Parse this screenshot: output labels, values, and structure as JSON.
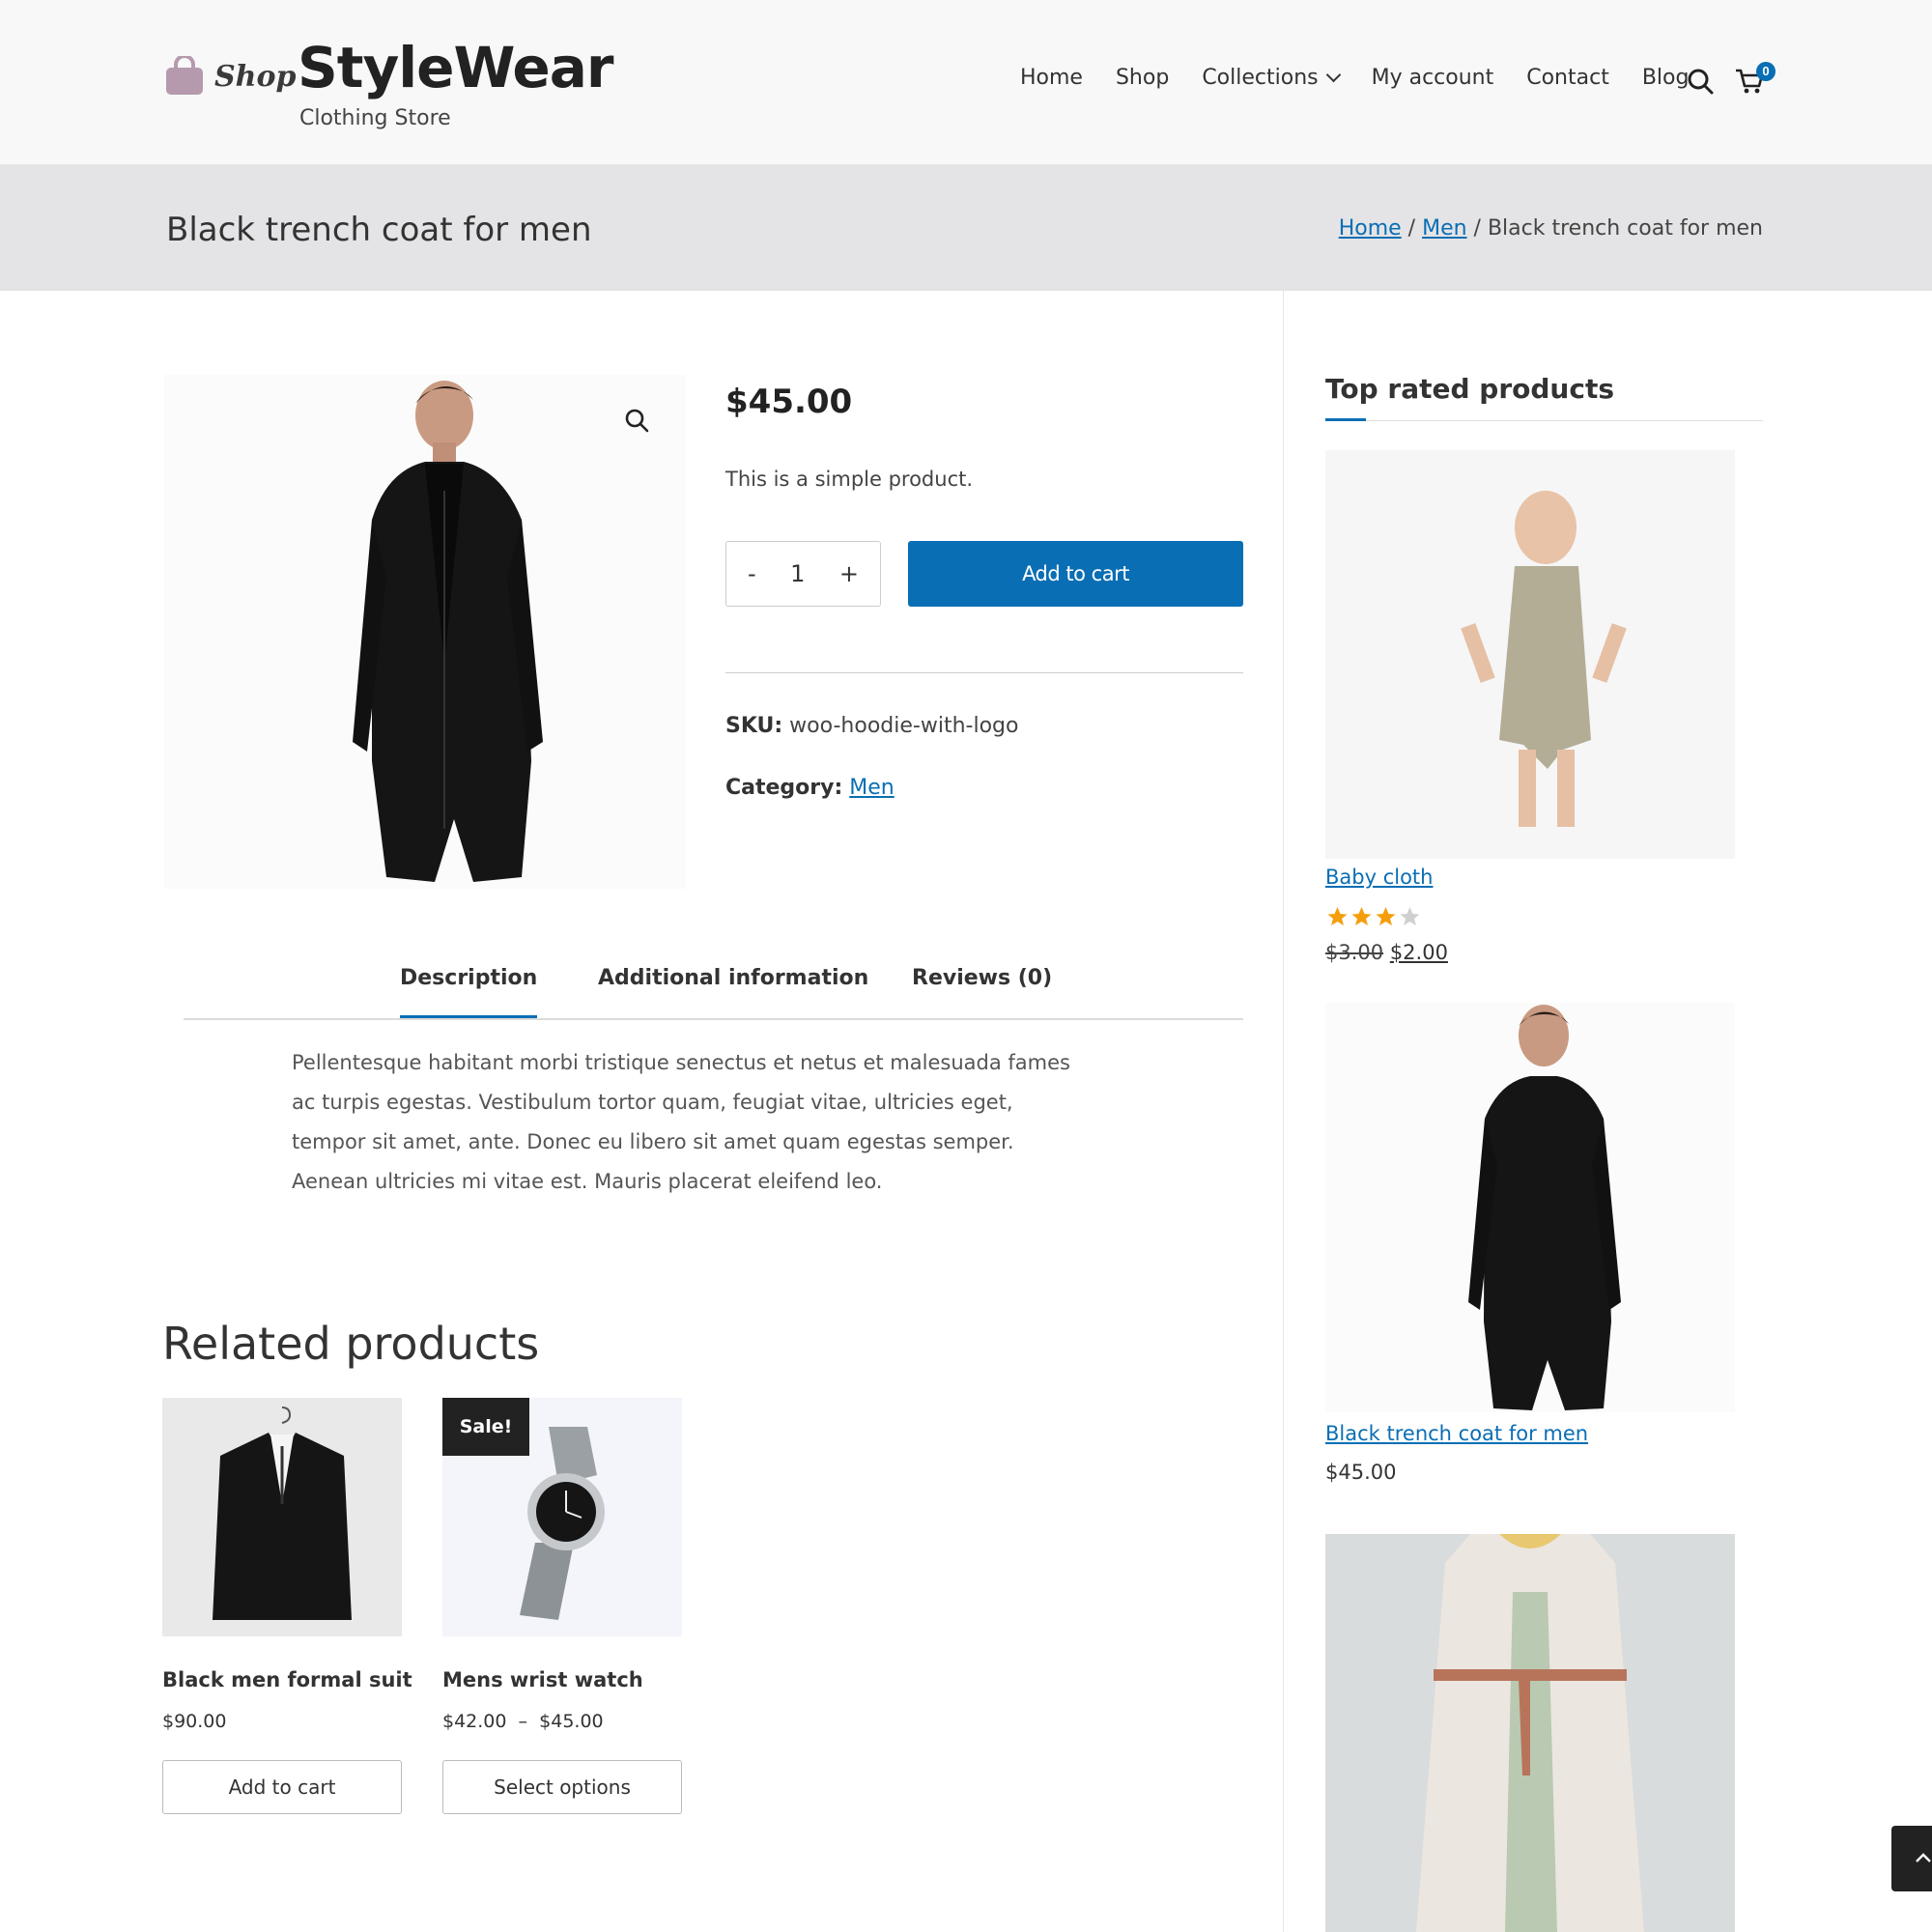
{
  "header": {
    "logo_text": "Shop",
    "site_title": "StyleWear",
    "tagline": "Clothing Store",
    "nav": [
      {
        "label": "Home"
      },
      {
        "label": "Shop"
      },
      {
        "label": "Collections",
        "has_dropdown": true
      },
      {
        "label": "My account"
      },
      {
        "label": "Contact"
      },
      {
        "label": "Blog"
      }
    ],
    "search_icon": "search-icon",
    "cart_icon": "cart-icon",
    "cart_count": "0",
    "accent_color": "#0a6eb4"
  },
  "title_bar": {
    "page_title": "Black trench coat for men",
    "breadcrumb": {
      "home": "Home",
      "sep1": " / ",
      "category": "Men",
      "sep2": " / ",
      "current": "Black trench coat for men"
    }
  },
  "product": {
    "price": "$45.00",
    "short_description": "This is a simple product.",
    "qty_minus": "-",
    "qty_value": "1",
    "qty_plus": "+",
    "add_to_cart": "Add to cart",
    "sku_label": "SKU:",
    "sku_value": "woo-hoodie-with-logo",
    "category_label": "Category:",
    "category_value": "Men",
    "zoom_icon": "magnifier-icon"
  },
  "tabs": [
    {
      "label": "Description",
      "active": true
    },
    {
      "label": "Additional information"
    },
    {
      "label": "Reviews (0)"
    }
  ],
  "description_text": "Pellentesque habitant morbi tristique senectus et netus et malesuada fames ac turpis egestas. Vestibulum tortor quam, feugiat vitae, ultricies eget, tempor sit amet, ante. Donec eu libero sit amet quam egestas semper. Aenean ultricies mi vitae est. Mauris placerat eleifend leo.",
  "related": {
    "heading": "Related products",
    "items": [
      {
        "title": "Black men formal suit",
        "price": "$90.00",
        "button": "Add to cart"
      },
      {
        "title": "Mens wrist watch",
        "price": "$42.00  –  $45.00",
        "button": "Select options",
        "badge": "Sale!"
      }
    ]
  },
  "sidebar": {
    "widget_title": "Top rated products",
    "items": [
      {
        "title": "Baby cloth",
        "rating": 3,
        "rating_max": 5,
        "old_price": "$3.00",
        "new_price": "$2.00"
      },
      {
        "title": "Black trench coat for men",
        "price": "$45.00"
      }
    ]
  }
}
